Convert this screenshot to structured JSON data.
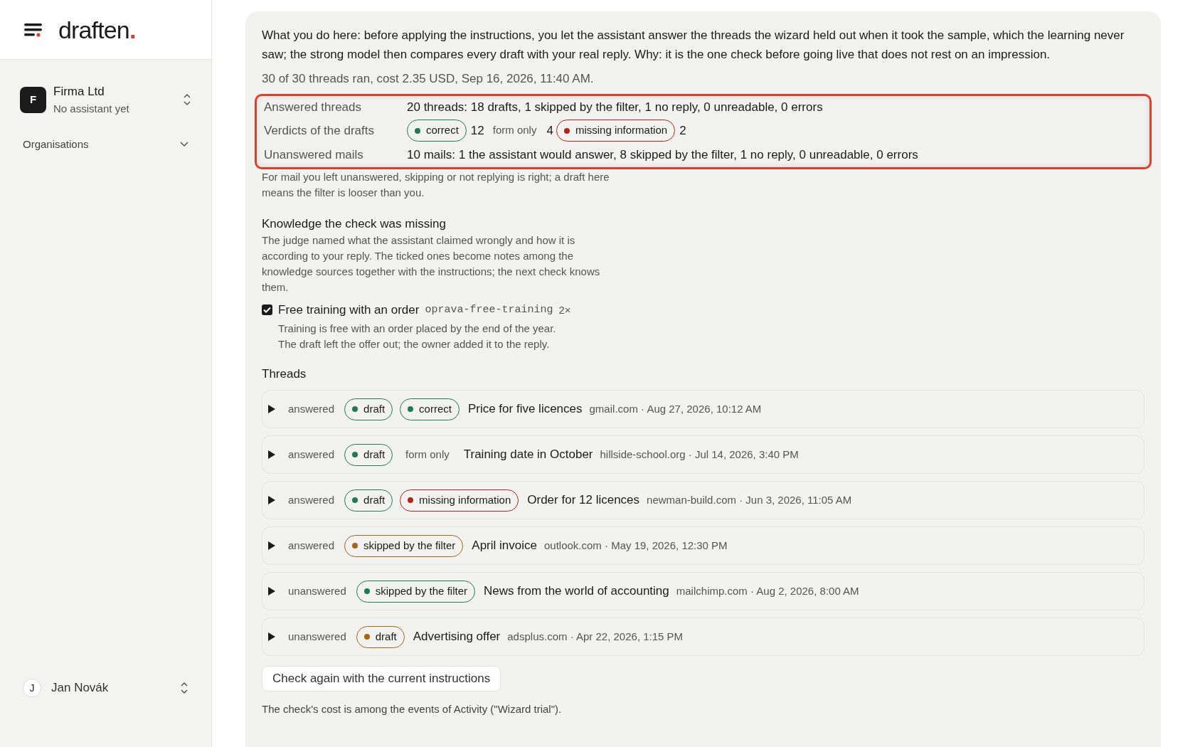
{
  "sidebar": {
    "logo": {
      "word": "draften",
      "dot": "."
    },
    "org": {
      "initial": "F",
      "name": "Firma Ltd",
      "subtitle": "No assistant yet"
    },
    "section": {
      "label": "Organisations",
      "expanded": false
    },
    "user": {
      "initial": "J",
      "name": "Jan Novák"
    }
  },
  "intro": "What you do here: before applying the instructions, you let the assistant answer the threads the wizard held out when it took the sample, which the learning never saw; the strong model then compares every draft with your real reply. Why: it is the one check before going live that does not rest on an impression.",
  "run_info": "30 of 30 threads ran, cost 2.35 USD, Sep 16, 2026, 11:40 AM.",
  "summary": {
    "highlighted": true,
    "answered": {
      "label": "Answered threads",
      "value": "20 threads: 18 drafts, 1 skipped by the filter, 1 no reply, 0 unreadable, 0 errors"
    },
    "verdicts": {
      "label": "Verdicts of the drafts",
      "items": [
        {
          "kind": "badge",
          "label": "correct",
          "color": "#1f7a5a",
          "count": "12"
        },
        {
          "kind": "plain",
          "label": "form only",
          "count": "4"
        },
        {
          "kind": "badge",
          "label": "missing information",
          "color": "#b42318",
          "count": "2"
        }
      ]
    },
    "unanswered": {
      "label": "Unanswered mails",
      "value": "10 mails: 1 the assistant would answer, 8 skipped by the filter, 1 no reply, 0 unreadable, 0 errors"
    }
  },
  "unanswered_note": "For mail you left unanswered, skipping or not replying is right; a draft here means the filter is looser than you.",
  "knowledge": {
    "title": "Knowledge the check was missing",
    "description": "The judge named what the assistant claimed wrongly and how it is according to your reply. The ticked ones become notes among the knowledge sources together with the instructions; the next check knows them.",
    "items": [
      {
        "title": "Free training with an order",
        "code": "oprava-free-training",
        "count": "2×",
        "checked": true,
        "lines": [
          "Training is free with an order placed by the end of the year.",
          "The draft left the offer out; the owner added it to the reply."
        ]
      }
    ]
  },
  "threads": {
    "title": "Threads",
    "rows": [
      {
        "expanded": false,
        "status": "answered",
        "chips": [
          {
            "kind": "badge",
            "label": "draft",
            "color": "#1f7a5a"
          },
          {
            "kind": "badge",
            "label": "correct",
            "color": "#1f7a5a"
          }
        ],
        "subject": "Price for five licences",
        "meta": "gmail.com · Aug 27, 2026, 10:12 AM"
      },
      {
        "expanded": false,
        "status": "answered",
        "chips": [
          {
            "kind": "badge",
            "label": "draft",
            "color": "#1f7a5a"
          },
          {
            "kind": "plain",
            "label": "form only"
          }
        ],
        "subject": "Training date in October",
        "meta": "hillside-school.org · Jul 14, 2026, 3:40 PM"
      },
      {
        "expanded": false,
        "status": "answered",
        "chips": [
          {
            "kind": "badge",
            "label": "draft",
            "color": "#1f7a5a"
          },
          {
            "kind": "badge",
            "label": "missing information",
            "color": "#b42318"
          }
        ],
        "subject": "Order for 12 licences",
        "meta": "newman-build.com · Jun 3, 2026, 11:05 AM"
      },
      {
        "expanded": false,
        "status": "answered",
        "chips": [
          {
            "kind": "badge",
            "label": "skipped by the filter",
            "color": "#a8650f"
          }
        ],
        "subject": "April invoice",
        "meta": "outlook.com · May 19, 2026, 12:30 PM"
      },
      {
        "expanded": false,
        "status": "unanswered",
        "chips": [
          {
            "kind": "badge",
            "label": "skipped by the filter",
            "color": "#1f7a5a"
          }
        ],
        "subject": "News from the world of accounting",
        "meta": "mailchimp.com · Aug 2, 2026, 8:00 AM"
      },
      {
        "expanded": false,
        "status": "unanswered",
        "chips": [
          {
            "kind": "badge",
            "label": "draft",
            "color": "#a8650f"
          }
        ],
        "subject": "Advertising offer",
        "meta": "adsplus.com · Apr 22, 2026, 1:15 PM"
      }
    ]
  },
  "recheck_button": "Check again with the current instructions",
  "footnote": "The check's cost is among the events of Activity (\"Wizard trial\")."
}
